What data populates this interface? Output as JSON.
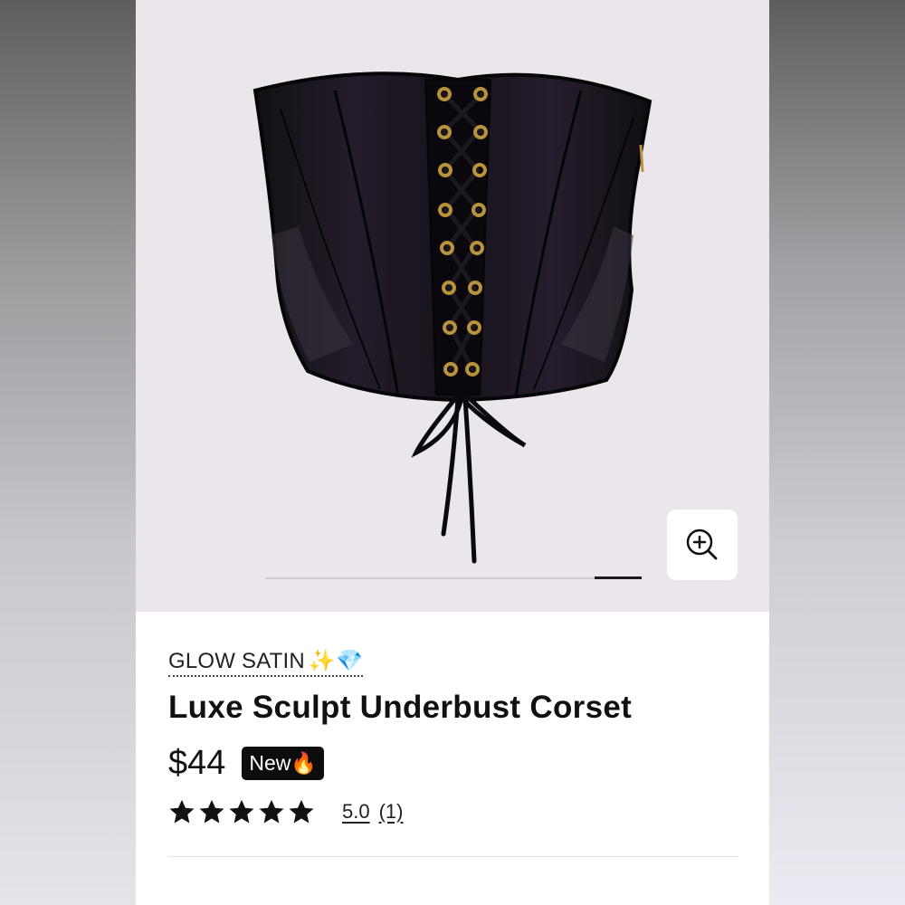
{
  "product": {
    "brand": "GLOW SATIN",
    "brand_emojis": "✨💎",
    "title": "Luxe Sculpt Underbust Corset",
    "price": "$44",
    "badge": "New🔥",
    "rating_value": "5.0",
    "rating_count": "(1)",
    "stars": 5
  },
  "gallery": {
    "image_count": 8,
    "active_index": 8,
    "zoom_icon": "zoom-in-icon"
  },
  "colors": {
    "gallery_background": "#eae6ec",
    "badge_background": "#0d0d0d",
    "text": "#111111"
  }
}
